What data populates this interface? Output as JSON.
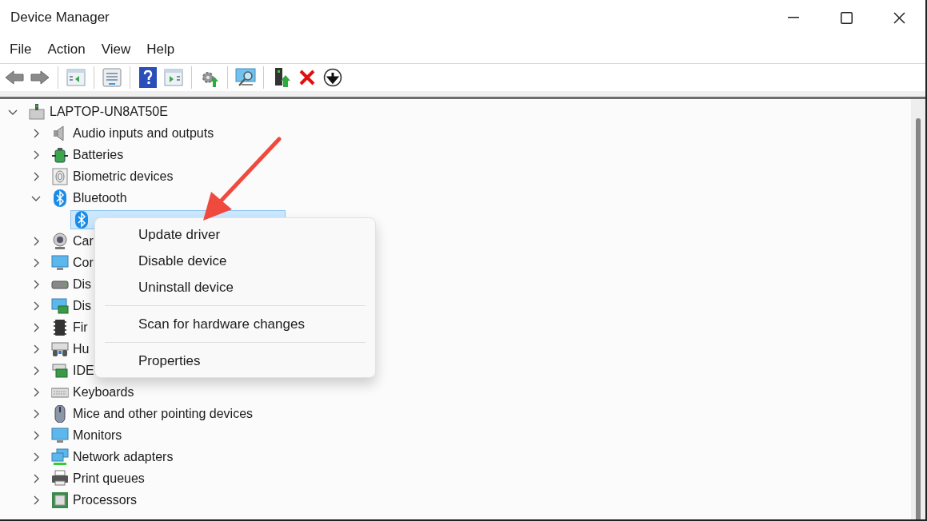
{
  "window": {
    "title": "Device Manager"
  },
  "menu_bar": [
    "File",
    "Action",
    "View",
    "Help"
  ],
  "tree": {
    "label": "LAPTOP-UN8AT50E",
    "expanded": true,
    "selected": false,
    "children": [
      {
        "label": "Audio inputs and outputs",
        "expanded": false,
        "selected": false
      },
      {
        "label": "Batteries",
        "expanded": false,
        "selected": false
      },
      {
        "label": "Biometric devices",
        "expanded": false,
        "selected": false
      },
      {
        "label": "Bluetooth",
        "expanded": true,
        "selected": false,
        "children": [
          {
            "selected": true
          }
        ]
      },
      {
        "label": "Car",
        "expanded": false,
        "selected": false
      },
      {
        "label": "Cor",
        "expanded": false,
        "selected": false
      },
      {
        "label": "Dis",
        "expanded": false,
        "selected": false
      },
      {
        "label": "Dis",
        "expanded": false,
        "selected": false
      },
      {
        "label": "Fir",
        "expanded": false,
        "selected": false
      },
      {
        "label": "Hu",
        "expanded": false,
        "selected": false
      },
      {
        "label": "IDE",
        "expanded": false,
        "selected": false
      },
      {
        "label": "Keyboards",
        "expanded": false,
        "selected": false
      },
      {
        "label": "Mice and other pointing devices",
        "expanded": false,
        "selected": false
      },
      {
        "label": "Monitors",
        "expanded": false,
        "selected": false
      },
      {
        "label": "Network adapters",
        "expanded": false,
        "selected": false
      },
      {
        "label": "Print queues",
        "expanded": false,
        "selected": false
      },
      {
        "label": "Processors",
        "expanded": false,
        "selected": false
      }
    ]
  },
  "context_menu": [
    {
      "kind": "item",
      "label": "Update driver"
    },
    {
      "kind": "item",
      "label": "Disable device"
    },
    {
      "kind": "item",
      "label": "Uninstall device"
    },
    {
      "kind": "separator"
    },
    {
      "kind": "item",
      "label": "Scan for hardware changes"
    },
    {
      "kind": "separator"
    },
    {
      "kind": "item",
      "label": "Properties"
    }
  ]
}
